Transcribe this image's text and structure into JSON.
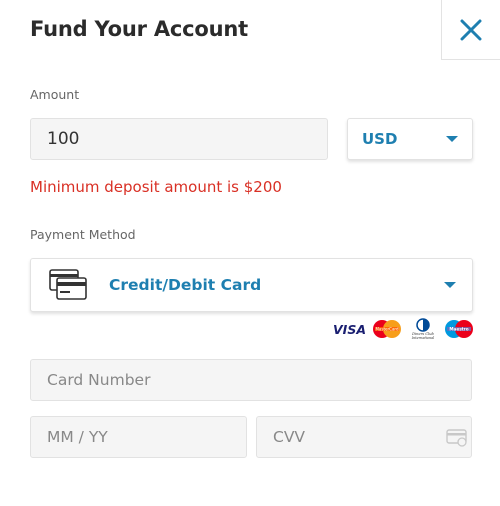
{
  "header": {
    "title": "Fund Your Account",
    "close_icon": "close-icon"
  },
  "amount": {
    "label": "Amount",
    "value": "100",
    "currency": "USD"
  },
  "error": {
    "message": "Minimum deposit amount is $200",
    "color": "#d93025"
  },
  "payment": {
    "label": "Payment Method",
    "selected": "Credit/Debit Card",
    "icon": "credit-card-icon",
    "brands": [
      "VISA",
      "MasterCard",
      "Diners Club International",
      "Maestro"
    ]
  },
  "card": {
    "number_placeholder": "Card Number",
    "expiry_placeholder": "MM / YY",
    "cvv_placeholder": "CVV"
  },
  "colors": {
    "accent": "#1e7fb0",
    "error": "#d93025",
    "input_bg": "#f5f5f5"
  }
}
